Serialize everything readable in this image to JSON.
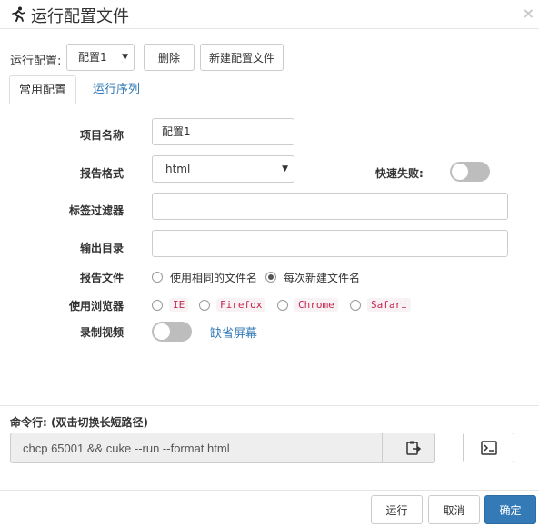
{
  "dialog": {
    "title": "运行配置文件",
    "close_glyph": "×",
    "icon": "running-person-icon"
  },
  "toolbar": {
    "config_label": "运行配置:",
    "selected_config": "配置1",
    "delete_label": "删除",
    "new_config_label": "新建配置文件"
  },
  "tabs": [
    {
      "label": "常用配置",
      "active": true
    },
    {
      "label": "运行序列",
      "active": false
    }
  ],
  "form": {
    "project_name_label": "项目名称",
    "project_name_value": "配置1",
    "report_format_label": "报告格式",
    "report_format_value": "html",
    "fail_fast_label": "快速失败:",
    "fail_fast_on": false,
    "tag_filter_label": "标签过滤器",
    "tag_filter_value": "",
    "output_dir_label": "输出目录",
    "output_dir_value": "",
    "report_file_label": "报告文件",
    "report_file_options": [
      {
        "label": "使用相同的文件名",
        "checked": false
      },
      {
        "label": "每次新建文件名",
        "checked": true
      }
    ],
    "browser_label": "使用浏览器",
    "browsers": [
      {
        "label": "IE",
        "checked": false
      },
      {
        "label": "Firefox",
        "checked": false
      },
      {
        "label": "Chrome",
        "checked": false
      },
      {
        "label": "Safari",
        "checked": false
      }
    ],
    "record_video_label": "录制视频",
    "record_video_on": false,
    "default_screen_link": "缺省屏幕"
  },
  "command": {
    "label": "命令行: (双击切换长短路径)",
    "value": "chcp 65001 && cuke --run --format html",
    "copy_icon": "clipboard-icon",
    "terminal_icon": "terminal-icon"
  },
  "footer": {
    "run_label": "运行",
    "cancel_label": "取消",
    "ok_label": "确定"
  },
  "colors": {
    "primary": "#337ab7",
    "link": "#337ab7",
    "toggle_off": "#bdbdbd",
    "code_text": "#c7254e",
    "code_bg": "#f9f2f4"
  }
}
